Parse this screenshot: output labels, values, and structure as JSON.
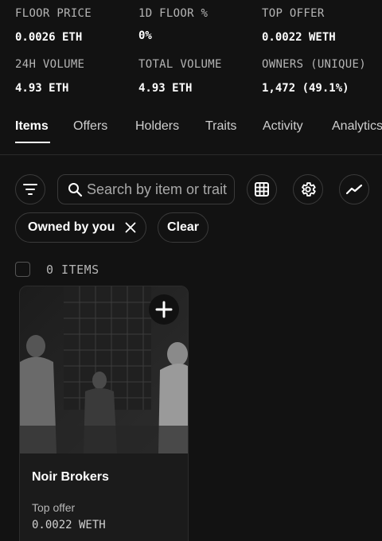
{
  "stats": [
    {
      "label": "FLOOR PRICE",
      "value": "0.0026 ETH"
    },
    {
      "label": "1D FLOOR %",
      "value": "0%"
    },
    {
      "label": "TOP OFFER",
      "value": "0.0022 WETH"
    },
    {
      "label": "24H VOLUME",
      "value": "4.93 ETH"
    },
    {
      "label": "TOTAL VOLUME",
      "value": "4.93 ETH"
    },
    {
      "label": "OWNERS (UNIQUE)",
      "value": "1,472 (49.1%)"
    }
  ],
  "tabs": [
    {
      "label": "Items",
      "active": true
    },
    {
      "label": "Offers"
    },
    {
      "label": "Holders"
    },
    {
      "label": "Traits"
    },
    {
      "label": "Activity"
    },
    {
      "label": "Analytics"
    }
  ],
  "toolbar": {
    "search_placeholder": "Search by item or trait",
    "filter_icon": "filter-icon",
    "grid_icon": "grid-icon",
    "settings_icon": "gear-icon",
    "chart_icon": "trend-line-icon"
  },
  "chips": {
    "owned_label": "Owned by you",
    "clear_label": "Clear"
  },
  "items": {
    "count_label": "0 ITEMS"
  },
  "card": {
    "title": "Noir Brokers",
    "offer_label": "Top offer",
    "offer_value": "0.0022 WETH"
  }
}
